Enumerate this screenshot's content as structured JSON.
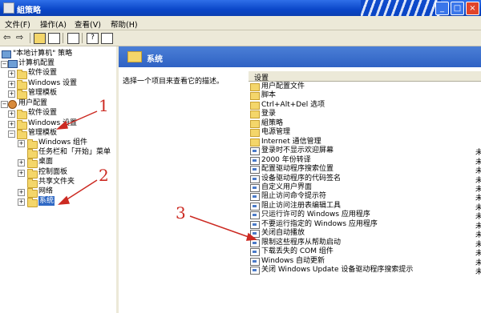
{
  "window": {
    "title": "組策略",
    "min": "_",
    "max": "□",
    "close": "×"
  },
  "menu": {
    "file": "文件(F)",
    "action": "操作(A)",
    "view": "查看(V)",
    "help": "帮助(H)"
  },
  "tree": {
    "root": "\"本地计算机\" 策略",
    "computer_config": "计算机配置",
    "cc_software": "软件设置",
    "cc_windows": "Windows 设置",
    "cc_admin": "管理模板",
    "user_config": "用户配置",
    "uc_software": "软件设置",
    "uc_windows": "Windows 设置",
    "uc_admin": "管理模板",
    "win_components": "Windows 组件",
    "taskbar": "任务栏和「开始」菜单",
    "desktop": "桌面",
    "control_panel": "控制面板",
    "shared_folders": "共享文件夹",
    "network": "网络",
    "system": "系统"
  },
  "right": {
    "header": "系统",
    "description": "选择一个项目来查看它的描述。",
    "column": "设置",
    "items": [
      "用户配置文件",
      "脚本",
      "Ctrl+Alt+Del 选项",
      "登录",
      "組策略",
      "电源管理",
      "Internet 通信管理",
      "登录时不显示欢迎屏幕",
      "2000 年份转译",
      "配置驱动程序搜索位置",
      "设备驱动程序的代码签名",
      "自定义用户界面",
      "阻止访问命令提示符",
      "阻止访问注册表编辑工具",
      "只运行许可的 Windows 应用程序",
      "不要运行指定的 Windows 应用程序",
      "关闭自动播放",
      "限制这些程序从帮助启动",
      "下载丢失的 COM 组件",
      "Windows 自动更新",
      "关闭 Windows Update 设备驱动程序搜索提示"
    ],
    "state_char": "未"
  },
  "annotations": {
    "one": "1",
    "two": "2",
    "three": "3"
  },
  "colors": {
    "annotation": "#cc2a22",
    "selection": "#316ac5",
    "titlebar": "#0a46c8"
  }
}
